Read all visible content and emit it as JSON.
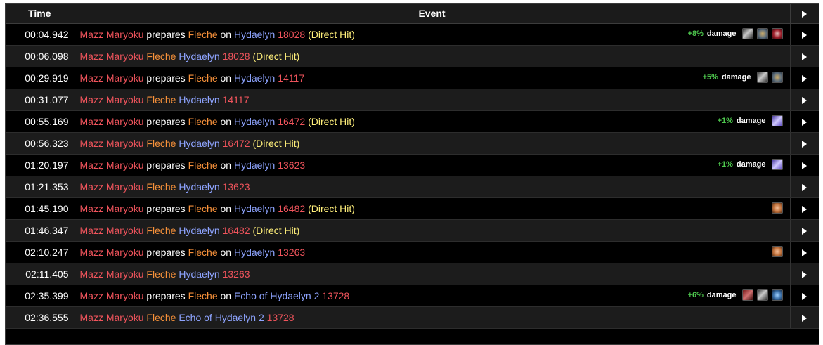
{
  "headers": {
    "time": "Time",
    "event": "Event"
  },
  "words": {
    "prepares": "prepares",
    "on": "on"
  },
  "rows": [
    {
      "time": "00:04.942",
      "source": "Mazz Maryoku",
      "prepares": true,
      "ability": "Fleche",
      "target": "Hydaelyn",
      "amount": "18028",
      "direct": "(Direct Hit)",
      "bonus_pct": "+8%",
      "bonus_label": "damage",
      "buffs": [
        "whetstone-buff-icon",
        "medal-buff-icon",
        "card-buff-icon"
      ]
    },
    {
      "time": "00:06.098",
      "source": "Mazz Maryoku",
      "prepares": false,
      "ability": "Fleche",
      "target": "Hydaelyn",
      "amount": "18028",
      "direct": "(Direct Hit)"
    },
    {
      "time": "00:29.919",
      "source": "Mazz Maryoku",
      "prepares": true,
      "ability": "Fleche",
      "target": "Hydaelyn",
      "amount": "14117",
      "direct": "",
      "bonus_pct": "+5%",
      "bonus_label": "damage",
      "buffs": [
        "whetstone-buff-icon",
        "medal-buff-icon"
      ]
    },
    {
      "time": "00:31.077",
      "source": "Mazz Maryoku",
      "prepares": false,
      "ability": "Fleche",
      "target": "Hydaelyn",
      "amount": "14117",
      "direct": ""
    },
    {
      "time": "00:55.169",
      "source": "Mazz Maryoku",
      "prepares": true,
      "ability": "Fleche",
      "target": "Hydaelyn",
      "amount": "16472",
      "direct": "(Direct Hit)",
      "bonus_pct": "+1%",
      "bonus_label": "damage",
      "buffs": [
        "crystal-buff-icon"
      ]
    },
    {
      "time": "00:56.323",
      "source": "Mazz Maryoku",
      "prepares": false,
      "ability": "Fleche",
      "target": "Hydaelyn",
      "amount": "16472",
      "direct": "(Direct Hit)"
    },
    {
      "time": "01:20.197",
      "source": "Mazz Maryoku",
      "prepares": true,
      "ability": "Fleche",
      "target": "Hydaelyn",
      "amount": "13623",
      "direct": "",
      "bonus_pct": "+1%",
      "bonus_label": "damage",
      "buffs": [
        "crystal-buff-icon"
      ]
    },
    {
      "time": "01:21.353",
      "source": "Mazz Maryoku",
      "prepares": false,
      "ability": "Fleche",
      "target": "Hydaelyn",
      "amount": "13623",
      "direct": ""
    },
    {
      "time": "01:45.190",
      "source": "Mazz Maryoku",
      "prepares": true,
      "ability": "Fleche",
      "target": "Hydaelyn",
      "amount": "16482",
      "direct": "(Direct Hit)",
      "bonus_pct": "",
      "bonus_label": "",
      "buffs": [
        "potion-buff-icon"
      ]
    },
    {
      "time": "01:46.347",
      "source": "Mazz Maryoku",
      "prepares": false,
      "ability": "Fleche",
      "target": "Hydaelyn",
      "amount": "16482",
      "direct": "(Direct Hit)"
    },
    {
      "time": "02:10.247",
      "source": "Mazz Maryoku",
      "prepares": true,
      "ability": "Fleche",
      "target": "Hydaelyn",
      "amount": "13263",
      "direct": "",
      "bonus_pct": "",
      "bonus_label": "",
      "buffs": [
        "potion-buff-icon"
      ]
    },
    {
      "time": "02:11.405",
      "source": "Mazz Maryoku",
      "prepares": false,
      "ability": "Fleche",
      "target": "Hydaelyn",
      "amount": "13263",
      "direct": ""
    },
    {
      "time": "02:35.399",
      "source": "Mazz Maryoku",
      "prepares": true,
      "ability": "Fleche",
      "target": "Echo of Hydaelyn 2",
      "amount": "13728",
      "direct": "",
      "bonus_pct": "+6%",
      "bonus_label": "damage",
      "buffs": [
        "sword-buff-icon",
        "whetstone-buff-icon",
        "shield-buff-icon"
      ]
    },
    {
      "time": "02:36.555",
      "source": "Mazz Maryoku",
      "prepares": false,
      "ability": "Fleche",
      "target": "Echo of Hydaelyn 2",
      "amount": "13728",
      "direct": ""
    }
  ]
}
